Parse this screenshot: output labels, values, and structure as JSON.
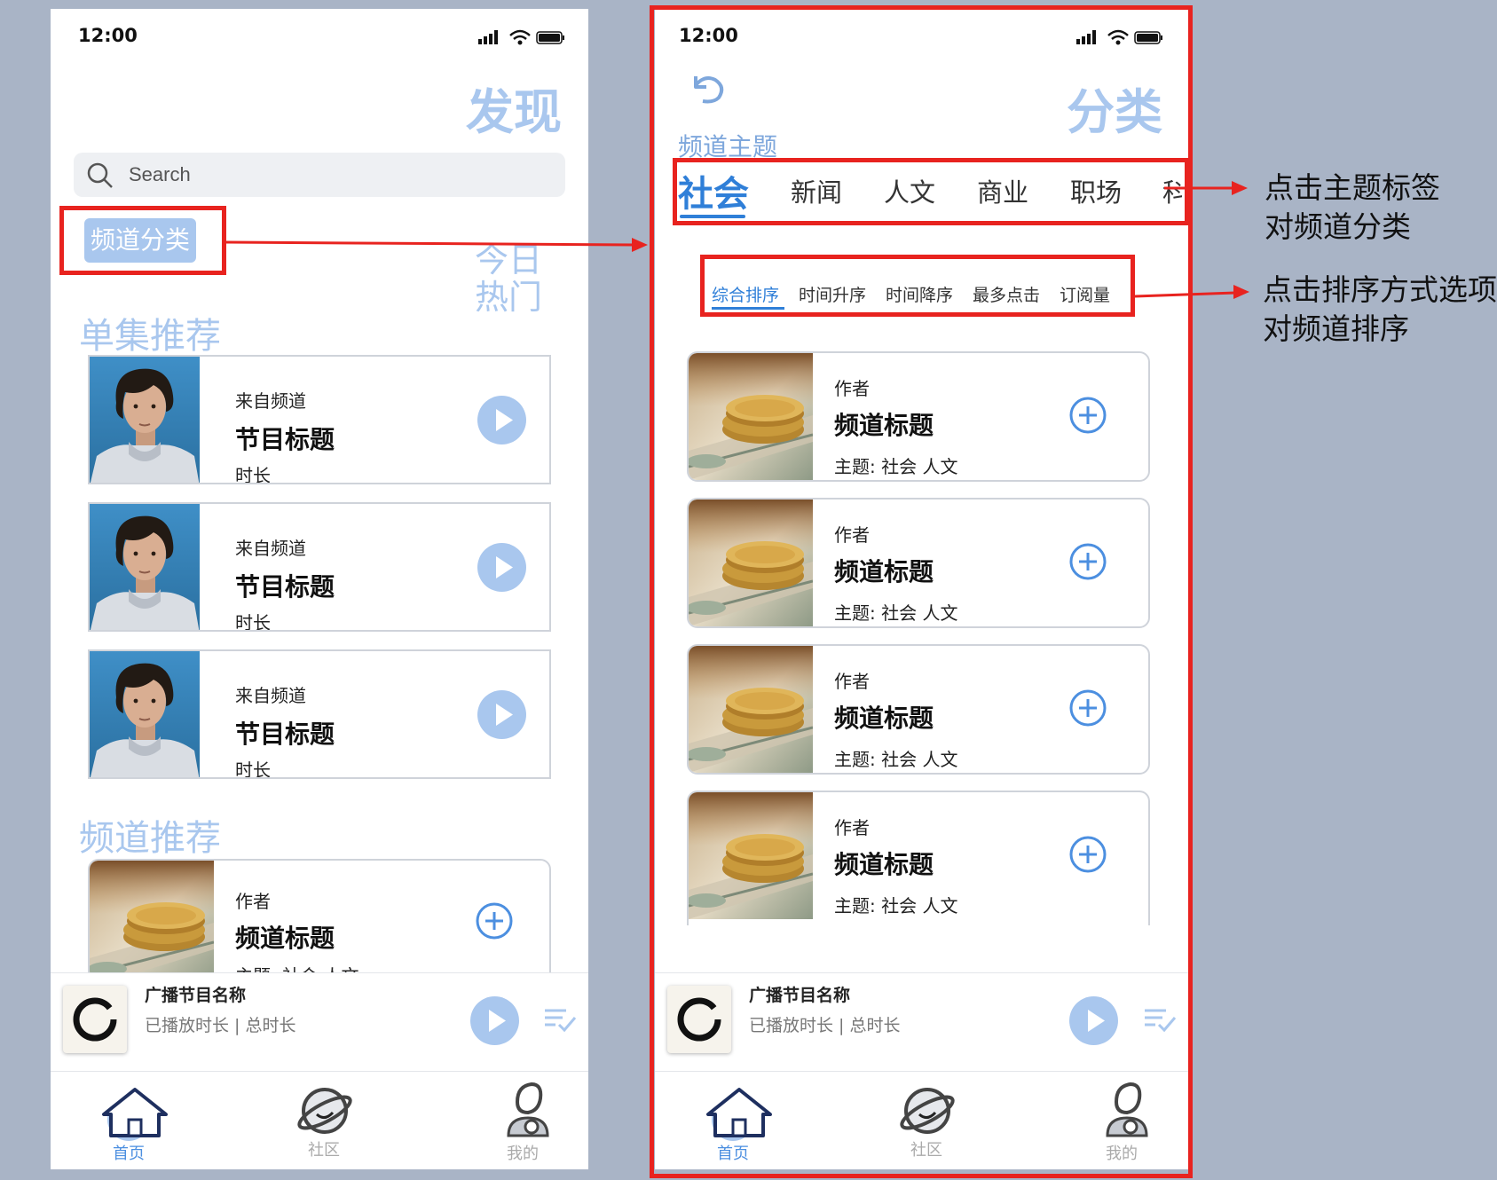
{
  "discover_screen": {
    "status_time": "12:00",
    "page_title": "发现",
    "search_placeholder": "Search",
    "category_chip": "频道分类",
    "hot_today": "今日\n热门",
    "episode_section_title": "单集推荐",
    "episodes": [
      {
        "source": "来自频道",
        "title": "节目标题",
        "duration": "时长"
      },
      {
        "source": "来自频道",
        "title": "节目标题",
        "duration": "时长"
      },
      {
        "source": "来自频道",
        "title": "节目标题",
        "duration": "时长"
      }
    ],
    "channel_section_title": "频道推荐",
    "channel_card": {
      "author": "作者",
      "title": "频道标题",
      "topics": "主题: 社会 人文"
    },
    "player": {
      "title": "广播节目名称",
      "subtitle": "已播放时长 | 总时长"
    },
    "tabs": [
      {
        "label": "首页",
        "icon": "home-icon",
        "active": true
      },
      {
        "label": "社区",
        "icon": "planet-icon",
        "active": false
      },
      {
        "label": "我的",
        "icon": "profile-icon",
        "active": false
      }
    ]
  },
  "category_screen": {
    "status_time": "12:00",
    "page_title": "分类",
    "topic_section_label": "频道主题",
    "topics": [
      "社会",
      "新闻",
      "人文",
      "商业",
      "职场",
      "科"
    ],
    "active_topic": "社会",
    "sort_options": [
      "综合排序",
      "时间升序",
      "时间降序",
      "最多点击",
      "订阅量"
    ],
    "active_sort": "综合排序",
    "channels": [
      {
        "author": "作者",
        "title": "频道标题",
        "topics": "主题: 社会 人文"
      },
      {
        "author": "作者",
        "title": "频道标题",
        "topics": "主题: 社会 人文"
      },
      {
        "author": "作者",
        "title": "频道标题",
        "topics": "主题: 社会 人文"
      },
      {
        "author": "作者",
        "title": "频道标题",
        "topics": "主题: 社会 人文"
      }
    ],
    "player": {
      "title": "广播节目名称",
      "subtitle": "已播放时长 | 总时长"
    },
    "tabs": [
      {
        "label": "首页",
        "icon": "home-icon",
        "active": true
      },
      {
        "label": "社区",
        "icon": "planet-icon",
        "active": false
      },
      {
        "label": "我的",
        "icon": "profile-icon",
        "active": false
      }
    ]
  },
  "annotations": {
    "topic_note": "点击主题标签\n对频道分类",
    "sort_note": "点击排序方式选项\n对频道排序"
  },
  "colors": {
    "accent": "#a9c7ee",
    "active_blue": "#2f7fd8",
    "annotation_red": "#e8231f",
    "background": "#a9b4c6"
  }
}
